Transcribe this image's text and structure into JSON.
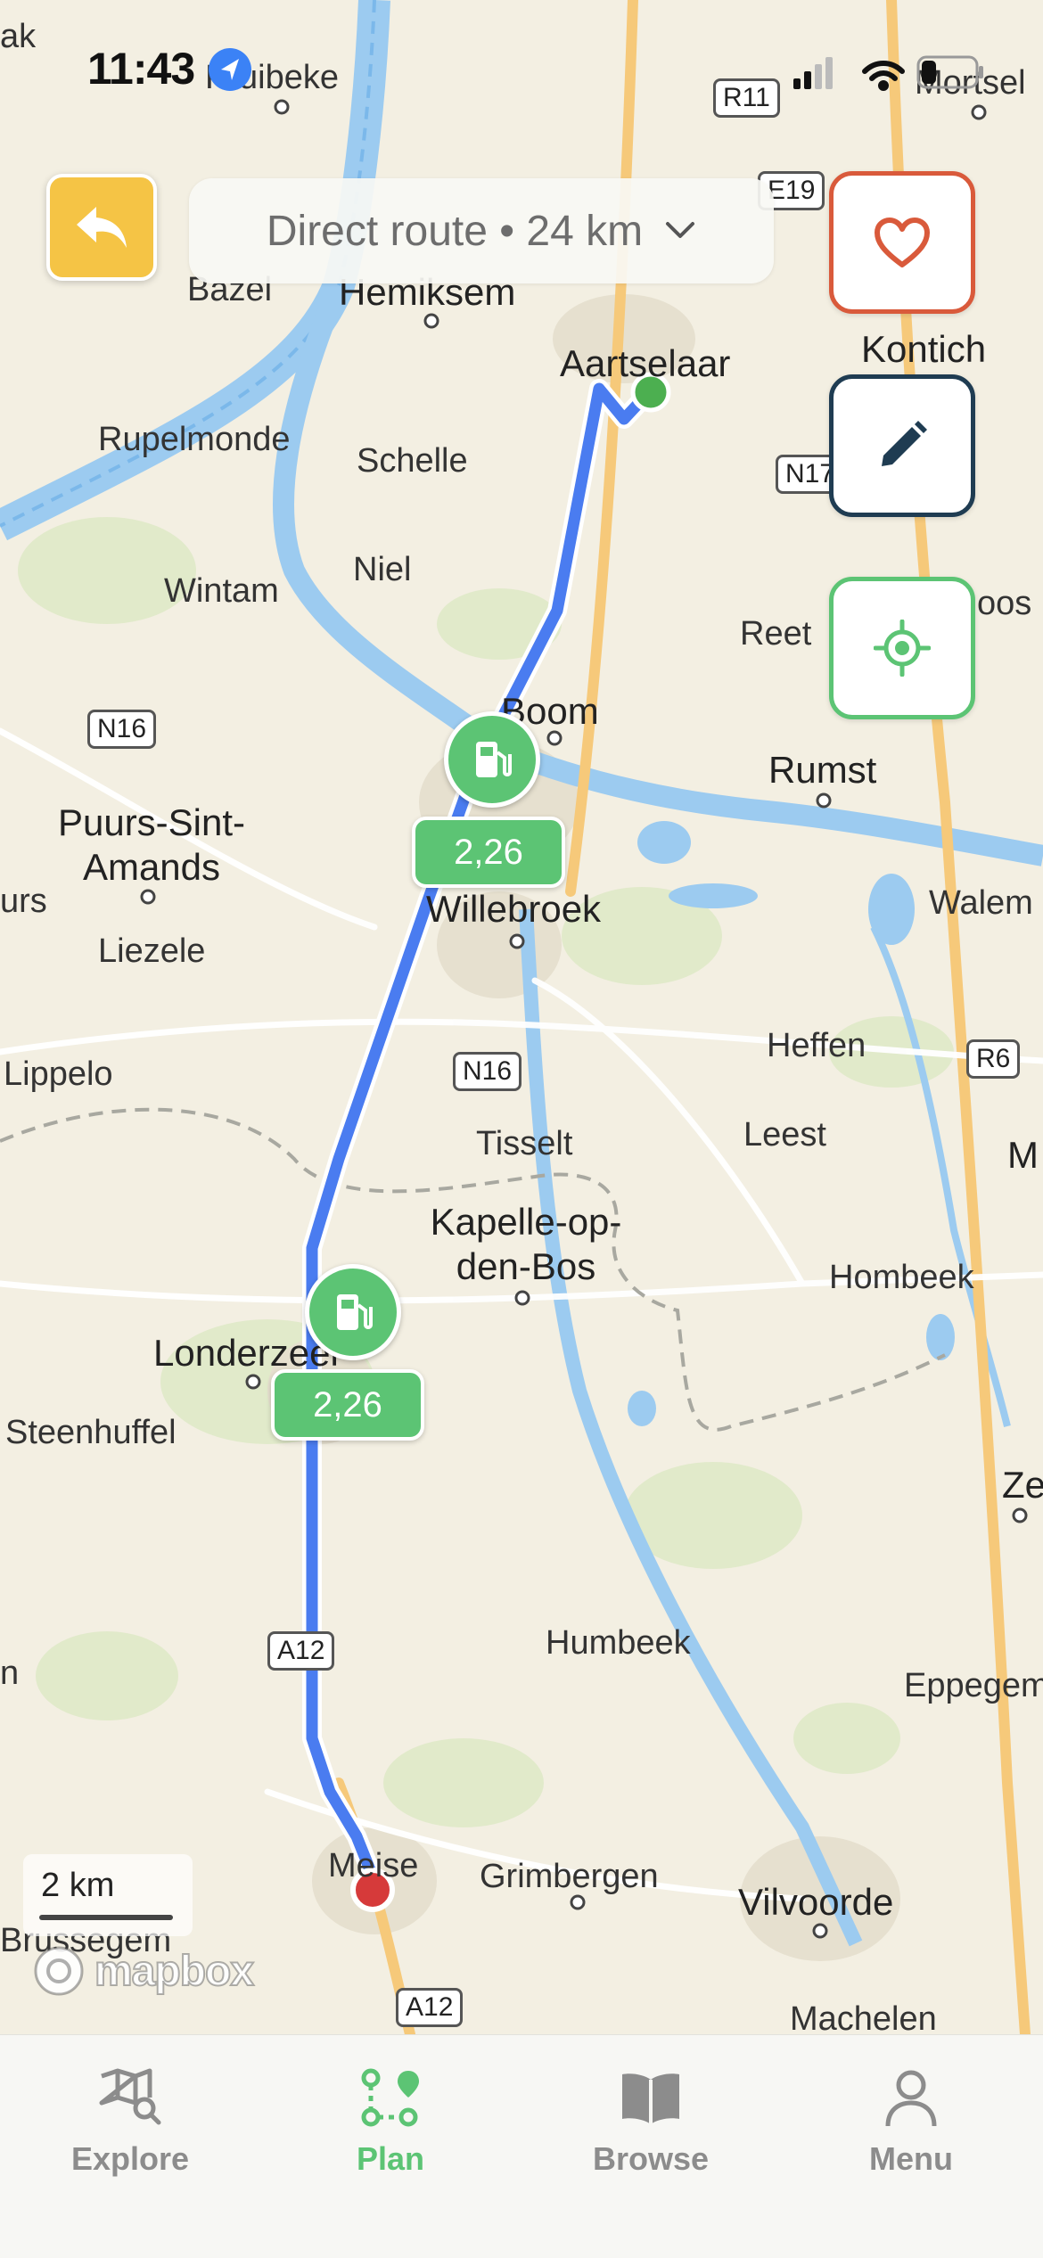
{
  "status_bar": {
    "time": "11:43"
  },
  "header": {
    "route_label": "Direct route • 24 km",
    "back_icon": "back-arrow-icon",
    "dropdown_icon": "chevron-down-icon"
  },
  "actions": {
    "favorite_icon": "heart-icon",
    "edit_icon": "pencil-icon",
    "locate_icon": "crosshair-icon"
  },
  "map": {
    "places": {
      "kruibeke": "Kruibeke",
      "mortsel": "Mortsel",
      "bazel": "Bazel",
      "hemiksem": "Hemiksem",
      "aartselaar": "Aartselaar",
      "kontich": "Kontich",
      "rupelmonde": "Rupelmonde",
      "schelle": "Schelle",
      "niel": "Niel",
      "wintam": "Wintam",
      "reet": "Reet",
      "boom": "Boom",
      "rumst": "Rumst",
      "puurs": "Puurs-Sint-Amands",
      "willebroek": "Willebroek",
      "walem": "Walem",
      "liezele": "Liezele",
      "heffen": "Heffen",
      "lippelo": "Lippelo",
      "tisselt": "Tisselt",
      "leest": "Leest",
      "kapelle": "Kapelle-op-den-Bos",
      "hombeek": "Hombeek",
      "londerzeel": "Londerzeel",
      "steenhuffel": "Steenhuffel",
      "humbeek": "Humbeek",
      "eppegem": "Eppegem",
      "meise": "Meise",
      "grimbergen": "Grimbergen",
      "vilvoorde": "Vilvoorde",
      "brussegem": "Brussegem",
      "machelen": "Machelen",
      "zemst": "Zem",
      "urs": "urs",
      "m": "M",
      "n": "n",
      "oos": "oos",
      "ak": "ak"
    },
    "roads": {
      "r11": "R11",
      "e19": "E19",
      "n17": "N17",
      "n16_west": "N16",
      "n16_mid": "N16",
      "r6": "R6",
      "a12_mid": "A12",
      "a12_south": "A12"
    },
    "fuel_stations": [
      {
        "price": "2,26"
      },
      {
        "price": "2,26"
      }
    ],
    "scale_label": "2 km",
    "attribution": "mapbox",
    "route_color": "#4a7cf0",
    "start_color": "#4caf50",
    "end_color": "#d63a3a"
  },
  "tabs": [
    {
      "label": "Explore",
      "icon": "map-search-icon",
      "active": false
    },
    {
      "label": "Plan",
      "icon": "route-plan-icon",
      "active": true
    },
    {
      "label": "Browse",
      "icon": "book-icon",
      "active": false
    },
    {
      "label": "Menu",
      "icon": "person-icon",
      "active": false
    }
  ],
  "colors": {
    "accent": "#5cc474",
    "back_button": "#f5c445",
    "favorite": "#d95a3b",
    "edit": "#1f3c52"
  }
}
